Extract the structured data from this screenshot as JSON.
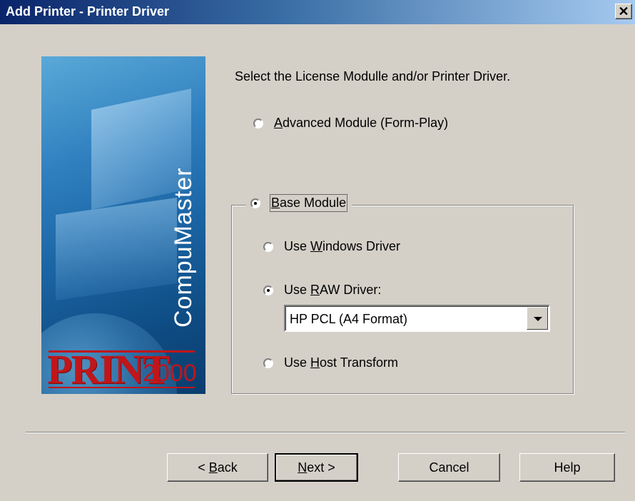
{
  "window": {
    "title": "Add Printer - Printer Driver",
    "close_label": "✕"
  },
  "side_image": {
    "brand": "CompuMaster",
    "logo_print": "PRINT",
    "logo_number": "2000"
  },
  "instruction": "Select the License Modulle and/or Printer Driver.",
  "options": {
    "advanced": {
      "label_pre": "",
      "label_u": "A",
      "label_post": "dvanced Module (Form-Play)",
      "checked": false
    },
    "base": {
      "label_pre": "",
      "label_u": "B",
      "label_post": "ase Module",
      "checked": true
    },
    "windows_driver": {
      "label_pre": "Use ",
      "label_u": "W",
      "label_post": "indows Driver",
      "checked": false
    },
    "raw_driver": {
      "label_pre": "Use ",
      "label_u": "R",
      "label_post": "AW Driver:",
      "checked": true
    },
    "host_transform": {
      "label_pre": "Use ",
      "label_u": "H",
      "label_post": "ost Transform",
      "checked": false
    }
  },
  "raw_driver_select": {
    "value": "HP PCL (A4 Format)"
  },
  "buttons": {
    "back": {
      "pre": "< ",
      "u": "B",
      "post": "ack"
    },
    "next": {
      "pre": "",
      "u": "N",
      "post": "ext >"
    },
    "cancel": "Cancel",
    "help": "Help"
  }
}
